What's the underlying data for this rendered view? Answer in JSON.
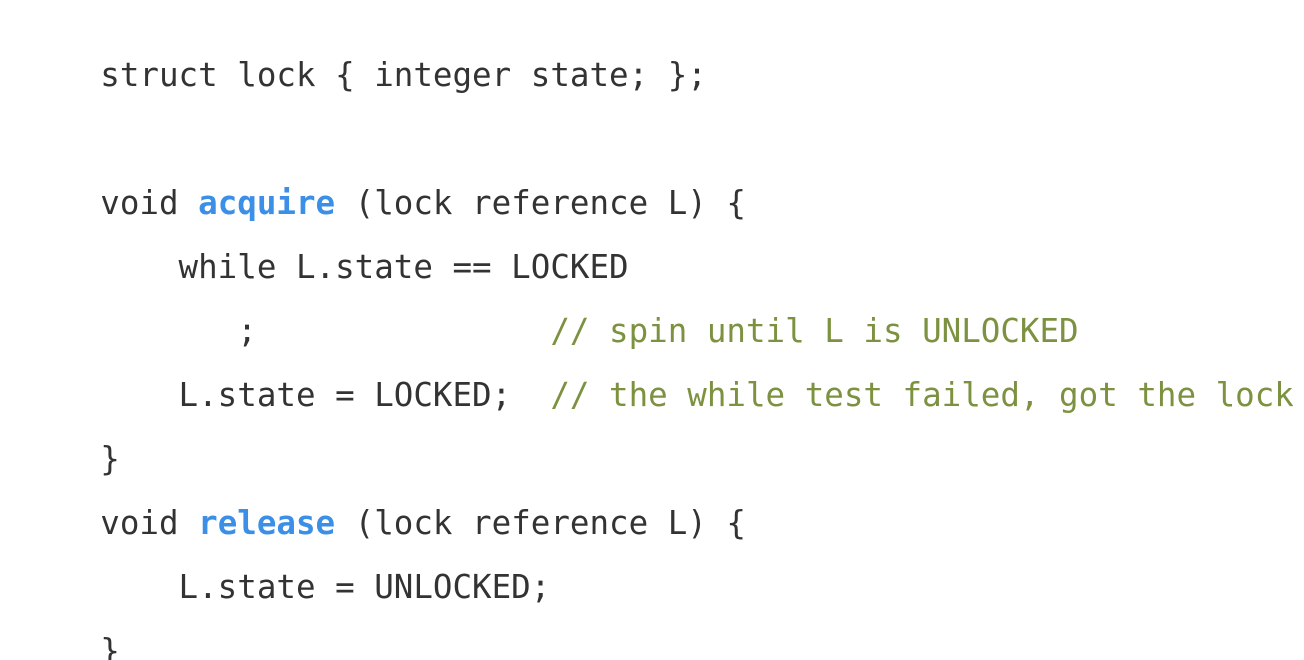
{
  "code": {
    "colors": {
      "text": "#333333",
      "function_name": "#3b8fe6",
      "comment": "#7c9240",
      "background": "#ffffff"
    },
    "lines": [
      {
        "text": "struct lock { integer state; };"
      },
      {
        "text": ""
      },
      {
        "prefix": "void ",
        "function": "acquire",
        "suffix": " (lock reference L) {"
      },
      {
        "text": "    while L.state == LOCKED"
      },
      {
        "text": "       ;               ",
        "comment": "// spin until L is UNLOCKED"
      },
      {
        "text": "    L.state = LOCKED;  ",
        "comment": "// the while test failed, got the lock"
      },
      {
        "text": "}"
      },
      {
        "prefix": "void ",
        "function": "release",
        "suffix": " (lock reference L) {"
      },
      {
        "text": "    L.state = UNLOCKED;"
      },
      {
        "text": "}"
      }
    ]
  }
}
